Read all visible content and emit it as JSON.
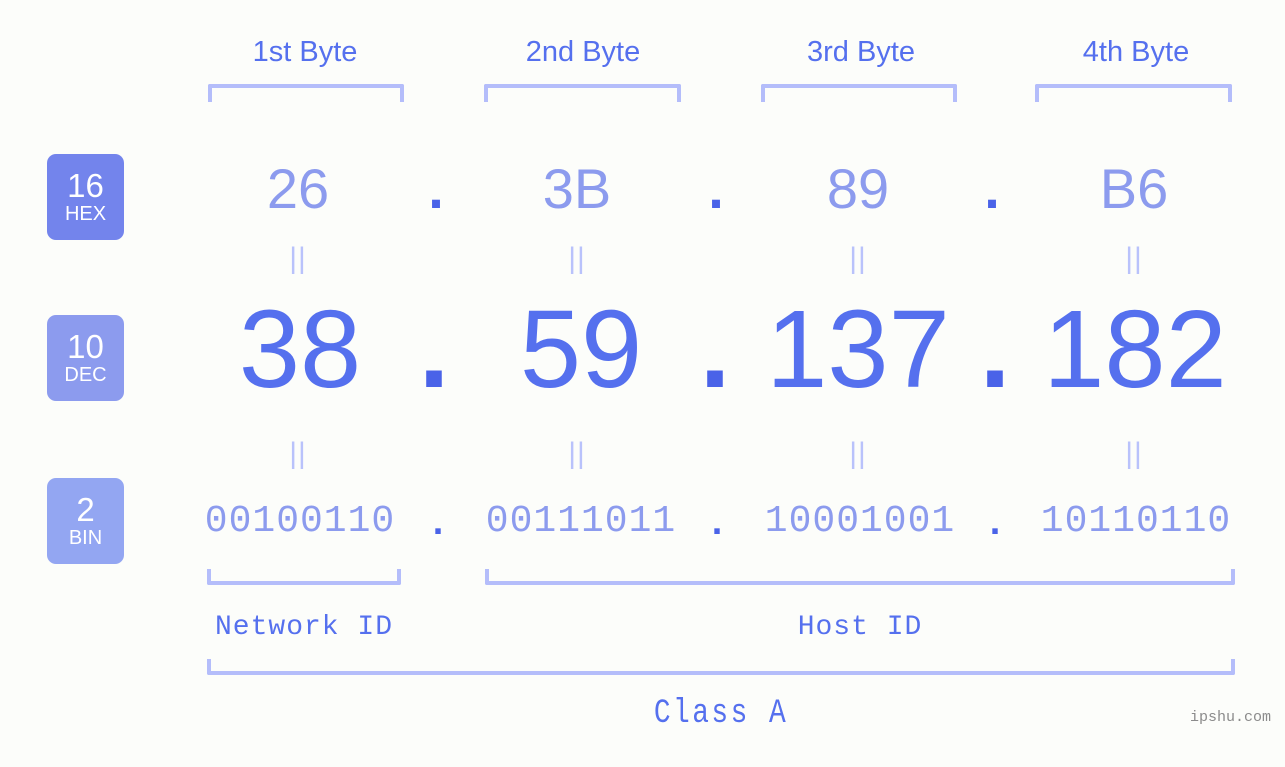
{
  "colors": {
    "background": "#fcfdfa",
    "accent_strong": "#5570ee",
    "accent_mid": "#8c9bee",
    "accent_light": "#b4bdfa",
    "dot": "#4a63e8",
    "badge_hex": "#7384ec",
    "badge_dec": "#8c9bee",
    "badge_bin": "#93a6f2",
    "watermark": "#8b8b8b"
  },
  "byte_headers": [
    {
      "label": "1st Byte"
    },
    {
      "label": "2nd Byte"
    },
    {
      "label": "3rd Byte"
    },
    {
      "label": "4th Byte"
    }
  ],
  "bases": [
    {
      "number": "16",
      "name": "HEX"
    },
    {
      "number": "10",
      "name": "DEC"
    },
    {
      "number": "2",
      "name": "BIN"
    }
  ],
  "rows": {
    "hex": {
      "values": [
        "26",
        "3B",
        "89",
        "B6"
      ],
      "separator": "."
    },
    "dec": {
      "values": [
        "38",
        "59",
        "137",
        "182"
      ],
      "separator": "."
    },
    "bin": {
      "values": [
        "00100110",
        "00111011",
        "10001001",
        "10110110"
      ],
      "separator": "."
    }
  },
  "equality_marks": {
    "row_hex_to_dec": [
      "||",
      "||",
      "||",
      "||"
    ],
    "row_dec_to_bin": [
      "||",
      "||",
      "||",
      "||"
    ]
  },
  "regions": [
    {
      "label": "Network ID"
    },
    {
      "label": "Host ID"
    }
  ],
  "class_label": "Class A",
  "watermark": "ipshu.com"
}
